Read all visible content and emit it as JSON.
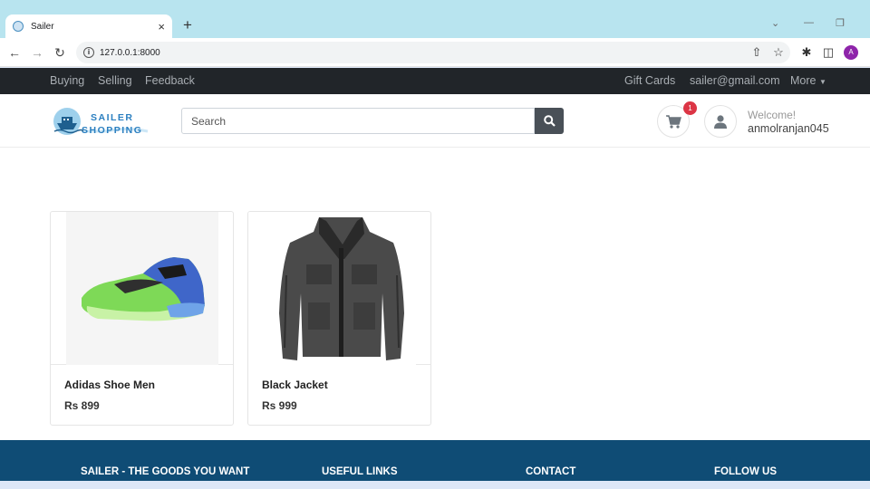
{
  "browser": {
    "tab_title": "Sailer",
    "tab_close": "×",
    "new_tab": "+",
    "url": "127.0.0.1:8000",
    "profile_initial": "A"
  },
  "topnav": {
    "left": [
      "Buying",
      "Selling",
      "Feedback"
    ],
    "gift_cards": "Gift Cards",
    "email": "sailer@gmail.com",
    "more": "More"
  },
  "header": {
    "logo_line1": "SAILER",
    "logo_line2": "SHOPPING",
    "search_placeholder": "Search",
    "cart_count": "1",
    "welcome": "Welcome!",
    "username": "anmolranjan045"
  },
  "products": [
    {
      "name": "Adidas Shoe Men",
      "price": "Rs 899"
    },
    {
      "name": "Black Jacket",
      "price": "Rs 999"
    }
  ],
  "footer": {
    "col1": "SAILER - THE GOODS YOU WANT",
    "col2": "USEFUL LINKS",
    "col3": "CONTACT",
    "col4": "FOLLOW US"
  },
  "colors": {
    "topnav_bg": "#212529",
    "footer_bg": "#0f4c75",
    "badge": "#dc3545",
    "search_button": "#495057"
  }
}
